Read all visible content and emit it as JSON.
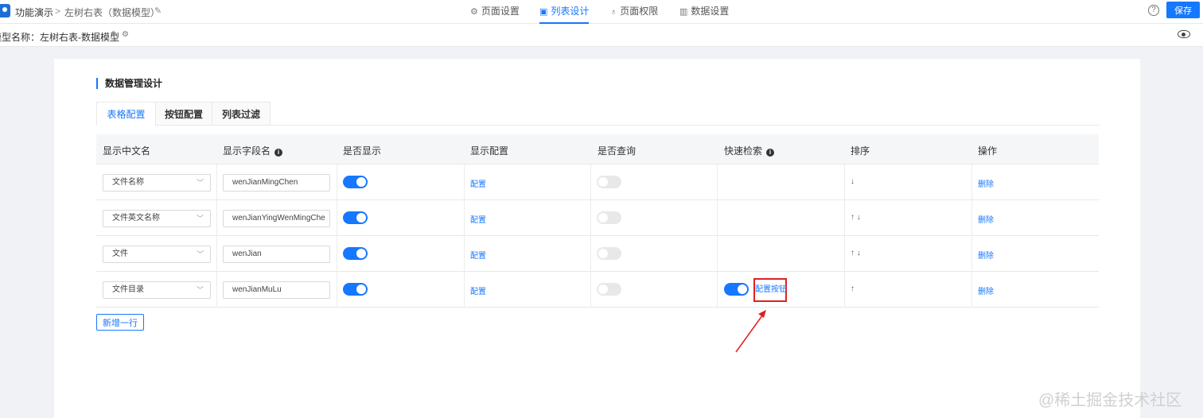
{
  "topbar": {
    "breadcrumb_root": "功能演示",
    "breadcrumb_sep": ">",
    "breadcrumb_current": "左树右表（数据模型）",
    "nav": [
      {
        "label": "页面设置",
        "icon": "gear-icon"
      },
      {
        "label": "列表设计",
        "icon": "list-design-icon",
        "active": true
      },
      {
        "label": "页面权限",
        "icon": "permission-icon"
      },
      {
        "label": "数据设置",
        "icon": "bar-chart-icon"
      }
    ],
    "help": "?",
    "save_label": "保存"
  },
  "subbar": {
    "model_label": "模型名称：左树右表-数据模型"
  },
  "main": {
    "section_title": "数据管理设计",
    "tabs": [
      {
        "label": "表格配置",
        "active": true
      },
      {
        "label": "按钮配置"
      },
      {
        "label": "列表过滤"
      }
    ],
    "table": {
      "headers": [
        "显示中文名",
        "显示字段名",
        "是否显示",
        "显示配置",
        "是否查询",
        "快速检索",
        "排序",
        "操作"
      ],
      "rows": [
        {
          "cn_name": "文件名称",
          "field": "wenJianMingChen",
          "show": true,
          "config": "配置",
          "query": false,
          "quick": false,
          "sort": "↓",
          "action": "删除"
        },
        {
          "cn_name": "文件英文名称",
          "field": "wenJianYingWenMingChe",
          "show": true,
          "config": "配置",
          "query": false,
          "quick": false,
          "sort": "↑  ↓",
          "action": "删除"
        },
        {
          "cn_name": "文件",
          "field": "wenJian",
          "show": true,
          "config": "配置",
          "query": false,
          "quick": false,
          "sort": "↑  ↓",
          "action": "删除"
        },
        {
          "cn_name": "文件目录",
          "field": "wenJianMuLu",
          "show": true,
          "config": "配置",
          "query": false,
          "quick": true,
          "quick_btn": "配置按钮",
          "sort": "↑",
          "action": "删除"
        }
      ]
    },
    "add_row_label": "新增一行"
  },
  "watermark": "@稀土掘金技术社区",
  "colors": {
    "accent": "#1677ff",
    "highlight": "#e02020"
  }
}
